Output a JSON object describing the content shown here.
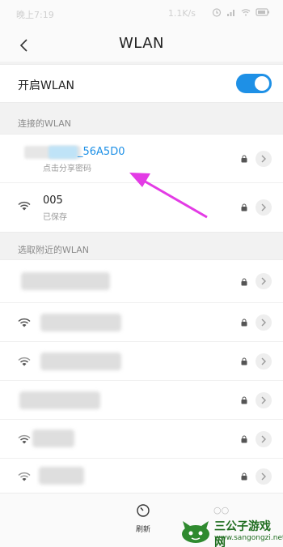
{
  "status_bar": {
    "time": "晚上7:19",
    "speed": "1.1K/s"
  },
  "header": {
    "title": "WLAN"
  },
  "wlan_toggle": {
    "label": "开启WLAN",
    "state": "on"
  },
  "connected_section": {
    "title": "连接的WLAN",
    "networks": [
      {
        "name": "_56A5D0",
        "subtitle": "点击分享密码",
        "status": "connected"
      },
      {
        "name": "005",
        "subtitle": "已保存"
      }
    ]
  },
  "nearby_section": {
    "title": "选取附近的WLAN"
  },
  "bottom": {
    "refresh_label": "刷新"
  },
  "watermark": {
    "brand": "三公子游戏网",
    "url": "www.sangongzi.net"
  },
  "colors": {
    "accent": "#1e90e6",
    "annotation_arrow": "#e33be5"
  }
}
